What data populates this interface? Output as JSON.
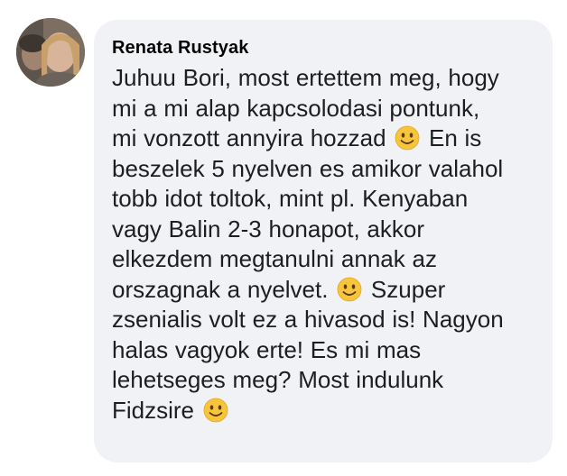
{
  "comment": {
    "author": "Renata Rustyak",
    "avatar_icon": "user-avatar",
    "emoji_icon": "slightly-smiling-face-icon",
    "lines": [
      {
        "before": "Juhuu Bori, most ertettem meg, hogy",
        "after": ""
      },
      {
        "before": "mi a mi alap kapcsolodasi pontunk,",
        "after": ""
      },
      {
        "before": "mi vonzott annyira hozzad ",
        "after": " En is"
      },
      {
        "before": "beszelek 5 nyelven es amikor valahol",
        "after": ""
      },
      {
        "before": "tobb idot toltok, mint pl. Kenyaban",
        "after": ""
      },
      {
        "before": "vagy Balin 2-3 honapot, akkor",
        "after": ""
      },
      {
        "before": "elkezdem megtanulni annak az",
        "after": ""
      },
      {
        "before": "orszagnak a nyelvet.  ",
        "after": "  Szuper"
      },
      {
        "before": "zsenialis volt ez a hivasod is! Nagyon",
        "after": ""
      },
      {
        "before": "halas vagyok erte!  Es mi mas",
        "after": ""
      },
      {
        "before": "lehetseges meg? Most indulunk",
        "after": ""
      },
      {
        "before": "Fidzsire ",
        "after": ""
      }
    ]
  }
}
